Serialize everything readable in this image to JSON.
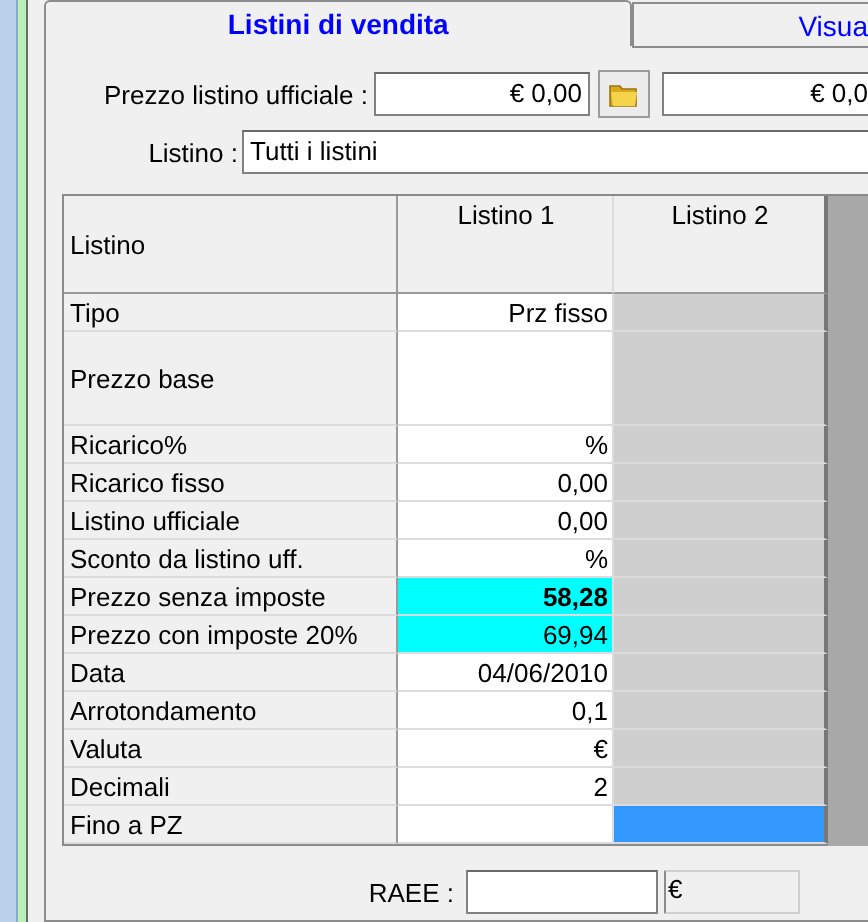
{
  "tabs": [
    {
      "label": "Listini di vendita",
      "selected": true
    },
    {
      "label": "Visua",
      "selected": false
    }
  ],
  "official_price": {
    "label": "Prezzo listino ufficiale :",
    "value": "€ 0,00",
    "value_2": "€ 0,0"
  },
  "listino": {
    "label": "Listino :",
    "value": "Tutti i listini"
  },
  "table": {
    "columns": [
      "Listino",
      "Listino 1",
      "Listino 2"
    ],
    "rows": [
      {
        "label": "Tipo",
        "value": "Prz fisso",
        "tall": false,
        "highlighted": false,
        "bold": false,
        "selected": false
      },
      {
        "label": "Prezzo base",
        "tall": true,
        "highlighted": false,
        "selected": false
      },
      {
        "label": "Ricarico%",
        "value": "%",
        "tall": false,
        "highlighted": false,
        "bold": false,
        "selected": false
      },
      {
        "label": "Ricarico fisso",
        "value": "0,00",
        "tall": false,
        "highlighted": false,
        "bold": false,
        "selected": false
      },
      {
        "label": "Listino ufficiale",
        "value": "0,00",
        "tall": false,
        "highlighted": false,
        "bold": false,
        "selected": false
      },
      {
        "label": "Sconto da listino uff.",
        "value": "%",
        "tall": false,
        "highlighted": false,
        "bold": false,
        "selected": false
      },
      {
        "label": "Prezzo senza imposte",
        "value": "58,28",
        "tall": false,
        "highlighted": true,
        "bold": true,
        "selected": false
      },
      {
        "label": "Prezzo con imposte 20%",
        "value": "69,94",
        "tall": false,
        "highlighted": true,
        "bold": false,
        "selected": false
      },
      {
        "label": "Data",
        "value": "04/06/2010",
        "tall": false,
        "highlighted": false,
        "bold": false,
        "selected": false
      },
      {
        "label": "Arrotondamento",
        "value": "0,1",
        "tall": false,
        "highlighted": false,
        "bold": false,
        "selected": false
      },
      {
        "label": "Valuta",
        "value": "€",
        "tall": false,
        "highlighted": false,
        "bold": false,
        "selected": false
      },
      {
        "label": "Decimali",
        "value": "2",
        "tall": false,
        "highlighted": false,
        "bold": false,
        "selected": false
      },
      {
        "label": "Fino a PZ",
        "tall": false,
        "highlighted": false,
        "selected": true
      }
    ]
  },
  "raee": {
    "label": "RAEE :",
    "unit": "€"
  }
}
